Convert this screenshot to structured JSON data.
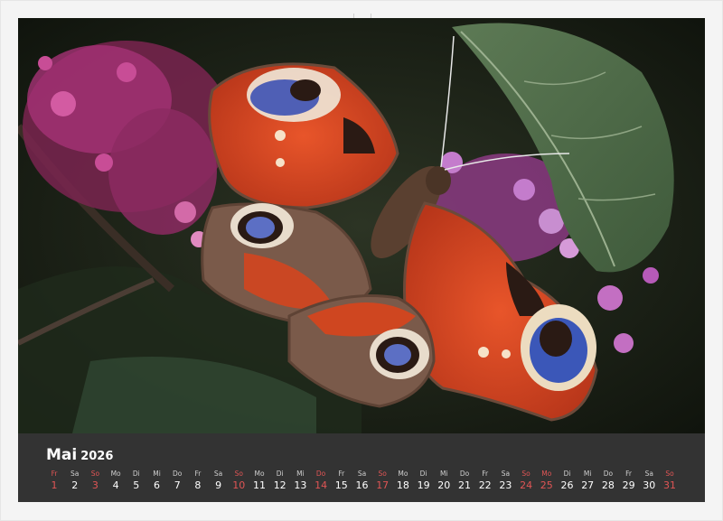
{
  "calendar": {
    "month": "Mai",
    "year": "2026",
    "days": [
      {
        "dn": "Fr",
        "num": "1",
        "weekend": true
      },
      {
        "dn": "Sa",
        "num": "2",
        "weekend": false
      },
      {
        "dn": "So",
        "num": "3",
        "weekend": true
      },
      {
        "dn": "Mo",
        "num": "4",
        "weekend": false
      },
      {
        "dn": "Di",
        "num": "5",
        "weekend": false
      },
      {
        "dn": "Mi",
        "num": "6",
        "weekend": false
      },
      {
        "dn": "Do",
        "num": "7",
        "weekend": false
      },
      {
        "dn": "Fr",
        "num": "8",
        "weekend": false
      },
      {
        "dn": "Sa",
        "num": "9",
        "weekend": false
      },
      {
        "dn": "So",
        "num": "10",
        "weekend": true
      },
      {
        "dn": "Mo",
        "num": "11",
        "weekend": false
      },
      {
        "dn": "Di",
        "num": "12",
        "weekend": false
      },
      {
        "dn": "Mi",
        "num": "13",
        "weekend": false
      },
      {
        "dn": "Do",
        "num": "14",
        "weekend": true
      },
      {
        "dn": "Fr",
        "num": "15",
        "weekend": false
      },
      {
        "dn": "Sa",
        "num": "16",
        "weekend": false
      },
      {
        "dn": "So",
        "num": "17",
        "weekend": true
      },
      {
        "dn": "Mo",
        "num": "18",
        "weekend": false
      },
      {
        "dn": "Di",
        "num": "19",
        "weekend": false
      },
      {
        "dn": "Mi",
        "num": "20",
        "weekend": false
      },
      {
        "dn": "Do",
        "num": "21",
        "weekend": false
      },
      {
        "dn": "Fr",
        "num": "22",
        "weekend": false
      },
      {
        "dn": "Sa",
        "num": "23",
        "weekend": false
      },
      {
        "dn": "So",
        "num": "24",
        "weekend": true
      },
      {
        "dn": "Mo",
        "num": "25",
        "weekend": true
      },
      {
        "dn": "Di",
        "num": "26",
        "weekend": false
      },
      {
        "dn": "Mi",
        "num": "27",
        "weekend": false
      },
      {
        "dn": "Do",
        "num": "28",
        "weekend": false
      },
      {
        "dn": "Fr",
        "num": "29",
        "weekend": false
      },
      {
        "dn": "Sa",
        "num": "30",
        "weekend": false
      },
      {
        "dn": "So",
        "num": "31",
        "weekend": true
      }
    ]
  },
  "photo": {
    "subject": "peacock-butterfly-on-buddleia",
    "colors": {
      "wing": "#d8441c",
      "eye_blue": "#3b57b8",
      "leaf": "#4d6b47",
      "flowers": "#c0418a"
    }
  }
}
